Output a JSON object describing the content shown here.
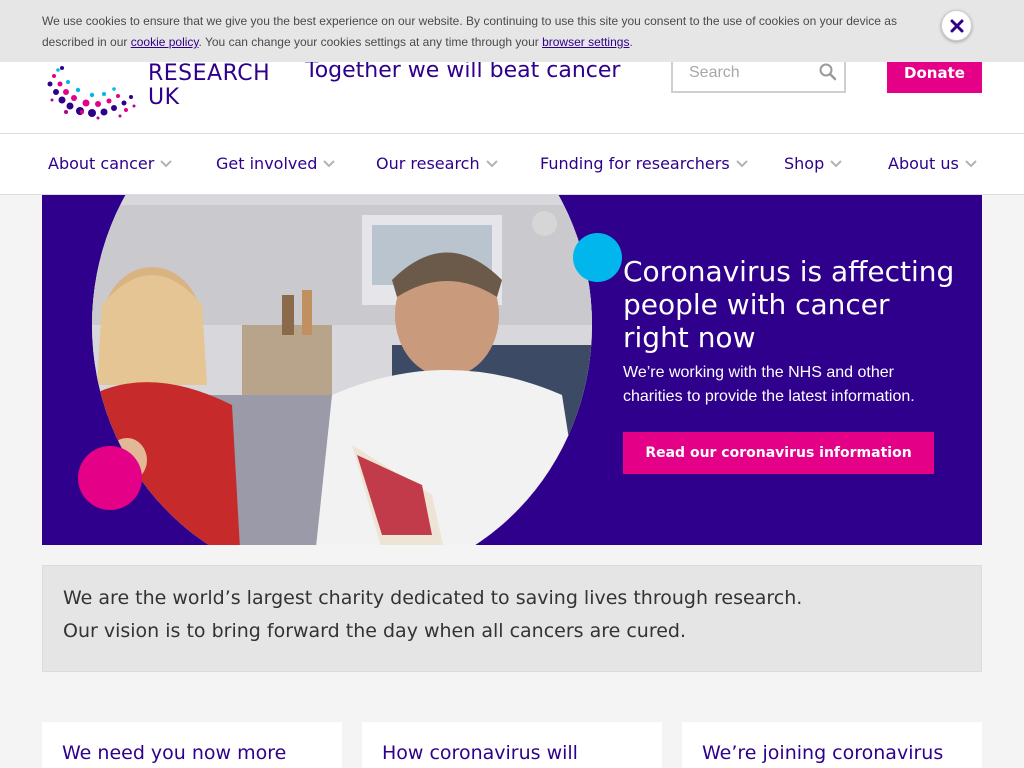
{
  "cookie_banner": {
    "text_before": "We use cookies to ensure that we give you the best experience on our website. By continuing to use this site you consent to the use of cookies on your device as described in our ",
    "cookie_policy_link": "cookie policy",
    "text_middle": ". You can change your cookies settings at any time through your ",
    "browser_settings_link": "browser settings",
    "text_after": "."
  },
  "header": {
    "logo_word_1": "RESEARCH",
    "logo_word_2": "UK",
    "tagline": "Together we will beat cancer",
    "search_placeholder": "Search",
    "donate_label": "Donate"
  },
  "nav": {
    "items": [
      {
        "label": "About cancer"
      },
      {
        "label": "Get involved"
      },
      {
        "label": "Our research"
      },
      {
        "label": "Funding for researchers"
      },
      {
        "label": "Shop"
      },
      {
        "label": "About us"
      }
    ]
  },
  "hero": {
    "title": "Coronavirus is affecting people with cancer right now",
    "subtitle": "We’re working with the NHS and other charities to provide the latest information.",
    "cta_label": "Read our coronavirus information"
  },
  "mission": {
    "line1": "We are the world’s largest charity dedicated to saving lives through research.",
    "line2": "Our vision is to bring forward the day when all cancers are cured."
  },
  "cards": [
    {
      "title": "We need you now more"
    },
    {
      "title": "How coronavirus will"
    },
    {
      "title": "We’re joining coronavirus"
    }
  ],
  "colors": {
    "brand_purple": "#2e008b",
    "brand_pink": "#e40087",
    "accent_cyan": "#00b6ed"
  },
  "icons": {
    "search": "search-icon",
    "close": "close-icon",
    "chevron": "chevron-down-icon"
  }
}
